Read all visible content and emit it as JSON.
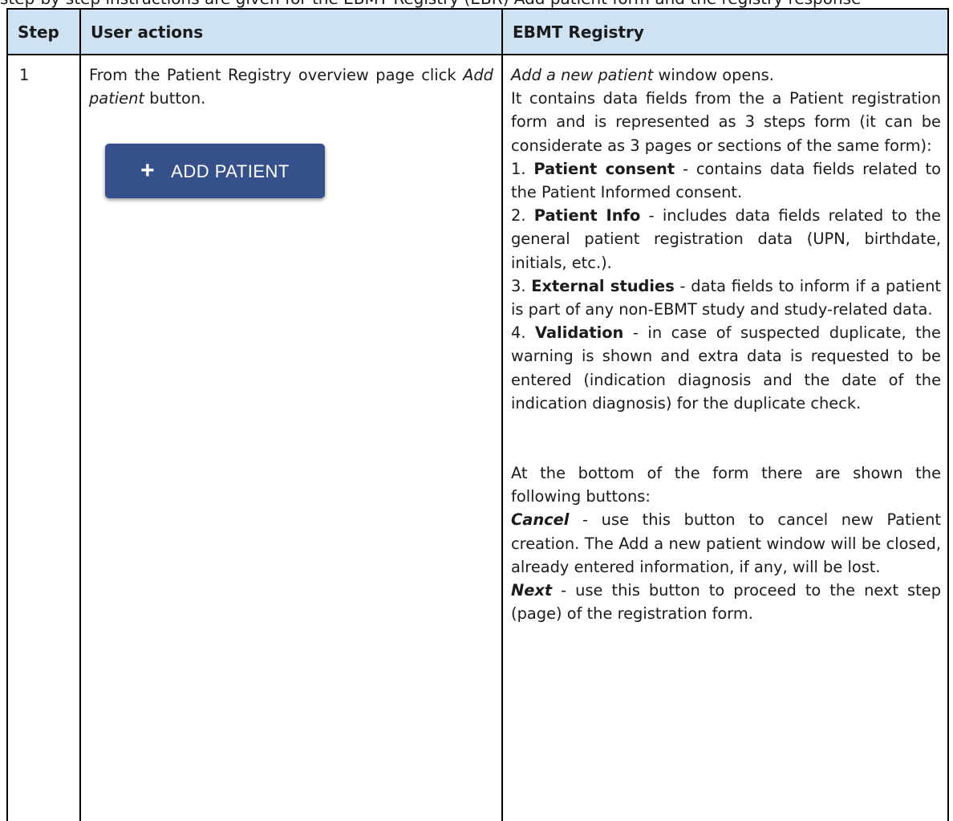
{
  "top_fragment": "step-by-step instructions are given for the EBMT Registry (EBR) Add patient form and the registry response",
  "headers": {
    "step": "Step",
    "user": "User actions",
    "ebmt": "EBMT Registry"
  },
  "row": {
    "step": "1",
    "user": {
      "text1": "From the Patient Registry overview page click ",
      "em": "Add patient",
      "text2": " button.",
      "button_label": "ADD PATIENT",
      "button_icon": "plus-icon"
    },
    "ebmt": {
      "intro_em": "Add a new patient",
      "intro_rest": " window opens.",
      "p1": "It contains data fields from the  a Patient registration form and is represented as 3 steps form (it can be considerate as 3 pages or sections of the same form):",
      "items": [
        {
          "num": "1. ",
          "bold": "Patient consent",
          "rest": " - contains data fields related to the Patient Informed consent."
        },
        {
          "num": "2. ",
          "bold": "Patient Info",
          "rest": " - includes data fields related to the general patient registration data (UPN, birthdate, initials, etc.)."
        },
        {
          "num": "3. ",
          "bold": "External studies",
          "rest": " - data fields to inform if a patient is part of any non-EBMT study and study-related data."
        },
        {
          "num": "4. ",
          "bold": "Validation",
          "rest": " - in case of suspected duplicate, the warning is shown and extra data is requested to be entered (indication diagnosis and the date of the indication diagnosis) for the duplicate check."
        }
      ],
      "p2": "At the bottom of the form there are shown the following buttons:",
      "buttons": [
        {
          "name": "Cancel",
          "rest": " - use this button to cancel new Patient creation. The Add a new patient window will be closed, already entered information, if any, will be lost."
        },
        {
          "name": "Next",
          "rest": " - use this button to proceed to the next step (page) of the registration form."
        }
      ]
    }
  }
}
